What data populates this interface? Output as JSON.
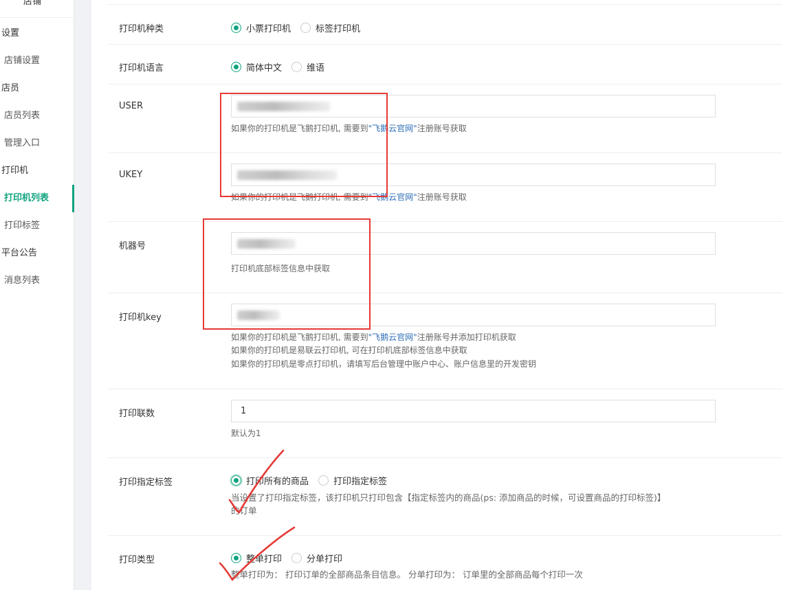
{
  "sidebar": {
    "top_label": "店铺",
    "items": [
      {
        "label": "设置",
        "type": "group"
      },
      {
        "label": "店铺设置",
        "type": "sub"
      },
      {
        "label": "店员",
        "type": "group"
      },
      {
        "label": "店员列表",
        "type": "sub"
      },
      {
        "label": "管理入口",
        "type": "sub"
      },
      {
        "label": "打印机",
        "type": "group"
      },
      {
        "label": "打印机列表",
        "type": "sub",
        "active": true
      },
      {
        "label": "打印标签",
        "type": "sub"
      },
      {
        "label": "平台公告",
        "type": "group"
      },
      {
        "label": "消息列表",
        "type": "sub"
      }
    ],
    "accent": "#10a37f"
  },
  "form": {
    "printer_type": {
      "label": "打印机种类",
      "options": [
        "小票打印机",
        "标签打印机"
      ],
      "selected": 0
    },
    "printer_lang": {
      "label": "打印机语言",
      "options": [
        "简体中文",
        "维语"
      ],
      "selected": 0
    },
    "user": {
      "label": "USER",
      "value": "",
      "help_pre": "如果你的打印机是飞鹅打印机, 需要到",
      "help_link": "\"飞鹅云官网\"",
      "help_post": "注册账号获取"
    },
    "ukey": {
      "label": "UKEY",
      "value": "",
      "help_pre": "如果你的打印机是飞鹅打印机, 需要到",
      "help_link": "\"飞鹅云官网\"",
      "help_post": "注册账号获取"
    },
    "machine_no": {
      "label": "机器号",
      "value": "",
      "help": "打印机底部标签信息中获取"
    },
    "printer_key": {
      "label": "打印机key",
      "value": "",
      "help1_pre": "如果你的打印机是飞鹅打印机, 需要到",
      "help1_link": "\"飞鹅云官网\"",
      "help1_post": "注册账号并添加打印机获取",
      "help2": "如果你的打印机是易联云打印机, 可在打印机底部标签信息中获取",
      "help3": "如果你的打印机是零点打印机，请填写后台管理中账户中心、账户信息里的开发密钥"
    },
    "copies": {
      "label": "打印联数",
      "value": "1",
      "help": "默认为1"
    },
    "tag": {
      "label": "打印指定标签",
      "options": [
        "打印所有的商品",
        "打印指定标签"
      ],
      "selected": 0,
      "help_line1": "当设置了打印指定标签，该打印机只打印包含【指定标签内的商品(ps: 添加商品的时候，可设置商品的打印标签)】",
      "help_line2": "的订单"
    },
    "print_mode": {
      "label": "打印类型",
      "options": [
        "整单打印",
        "分单打印"
      ],
      "selected": 0,
      "help": "整单打印为： 打印订单的全部商品条目信息。 分单打印为： 订单里的全部商品每个打印一次"
    }
  },
  "annotation_color": "#e53935"
}
